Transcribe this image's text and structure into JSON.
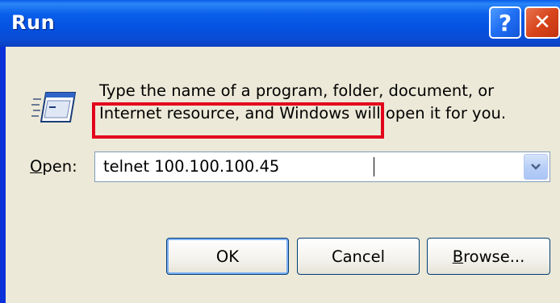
{
  "window": {
    "title": "Run",
    "help_button": "?",
    "close_button": "✕"
  },
  "description": {
    "line1": "Type the name of a program, folder, document, or",
    "line2": "Internet resource, and Windows will open it for you."
  },
  "open": {
    "label_accel": "O",
    "label_rest": "pen:",
    "value": "telnet 100.100.100.45"
  },
  "buttons": {
    "ok": "OK",
    "cancel": "Cancel",
    "browse_accel": "B",
    "browse_rest": "rowse..."
  },
  "colors": {
    "titlebar": "#0a5fea",
    "client": "#ece9d8",
    "highlight": "#e3001b",
    "close_button": "#d8451c"
  },
  "icons": [
    "run-icon",
    "help-icon",
    "close-icon",
    "chevron-down-icon"
  ]
}
